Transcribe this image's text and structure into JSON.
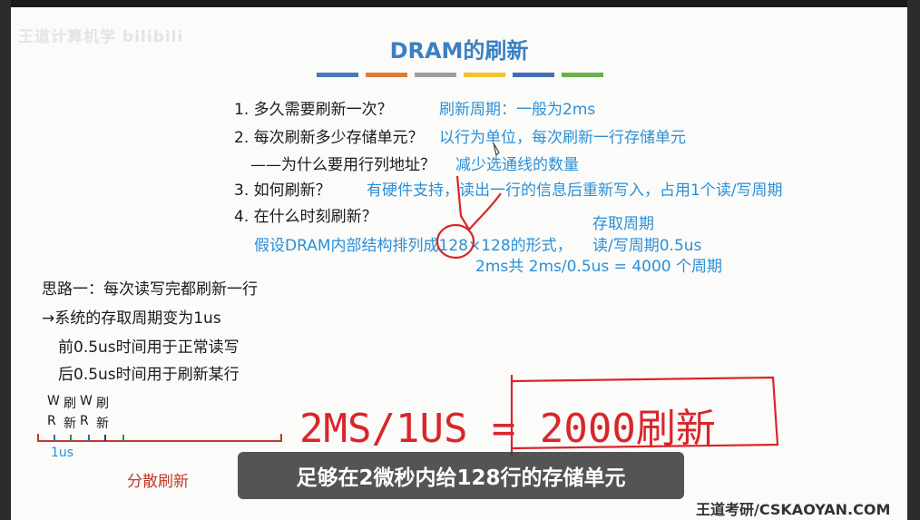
{
  "watermark": "王道计算机学 bilibili",
  "title": "DRAM的刷新",
  "color_bars": [
    "#4a78b8",
    "#e07b39",
    "#9e9e9e",
    "#f2c12e",
    "#3f6eb5",
    "#6ab04c"
  ],
  "questions": [
    {
      "q": "1. 多久需要刷新一次？",
      "a": "刷新周期：一般为2ms"
    },
    {
      "q": "2. 每次刷新多少存储单元？",
      "a": "以行为单位，每次刷新一行存储单元"
    },
    {
      "q": "——为什么要用行列地址？",
      "a": "减少选通线的数量"
    },
    {
      "q": "3. 如何刷新？",
      "a": "有硬件支持，读出一行的信息后重新写入，占用1个读/写周期"
    },
    {
      "q": "4. 在什么时刻刷新？",
      "a": ""
    }
  ],
  "assumption": {
    "line1": "假设DRAM内部结构排列成128×128的形式，",
    "label": "存取周期",
    "rw_cycle": "读/写周期0.5us",
    "line2": "2ms共 2ms/0.5us = 4000 个周期"
  },
  "idea": {
    "title": "思路一：每次读写完都刷新一行",
    "arrow_line": "→系统的存取周期变为1us",
    "line1": "前0.5us时间用于正常读写",
    "line2": "后0.5us时间用于刷新某行"
  },
  "timeline": {
    "top_labels": [
      "W",
      "刷",
      "W",
      "刷"
    ],
    "bottom_labels": [
      "R",
      "新",
      "R",
      "新"
    ],
    "unit": "1us",
    "caption": "分散刷新"
  },
  "handwriting": "2MS/1US = 2000刷新",
  "subtitle": "足够在2微秒内给128行的存储单元",
  "brand": "王道考研/CSKAOYAN.COM"
}
